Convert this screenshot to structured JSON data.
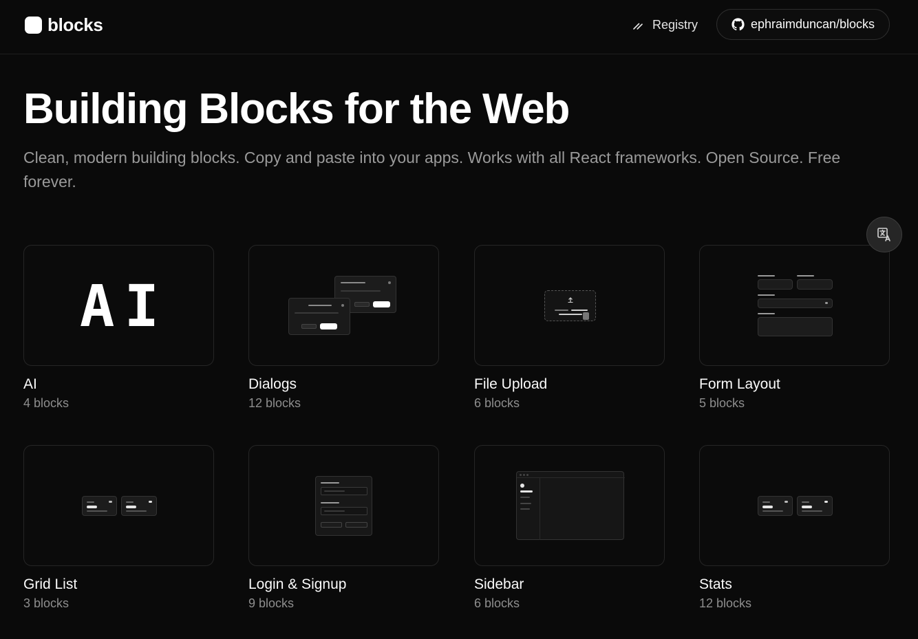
{
  "header": {
    "brand": "blocks",
    "registry_label": "Registry",
    "github_label": "ephraimduncan/blocks"
  },
  "hero": {
    "title": "Building Blocks for the Web",
    "subtitle": "Clean, modern building blocks. Copy and paste into your apps. Works with all React frameworks. Open Source. Free forever."
  },
  "categories": [
    {
      "title": "AI",
      "count": "4 blocks",
      "thumb_text": "AI"
    },
    {
      "title": "Dialogs",
      "count": "12 blocks"
    },
    {
      "title": "File Upload",
      "count": "6 blocks"
    },
    {
      "title": "Form Layout",
      "count": "5 blocks"
    },
    {
      "title": "Grid List",
      "count": "3 blocks"
    },
    {
      "title": "Login & Signup",
      "count": "9 blocks"
    },
    {
      "title": "Sidebar",
      "count": "6 blocks"
    },
    {
      "title": "Stats",
      "count": "12 blocks"
    }
  ],
  "icons": {
    "brand": "blocks-logo-icon",
    "registry": "pencil-icon",
    "github": "github-icon",
    "translate": "translate-icon"
  },
  "colors": {
    "background": "#0a0a0a",
    "text": "#fafafa",
    "muted": "#8e8e8e",
    "border": "#262626"
  }
}
